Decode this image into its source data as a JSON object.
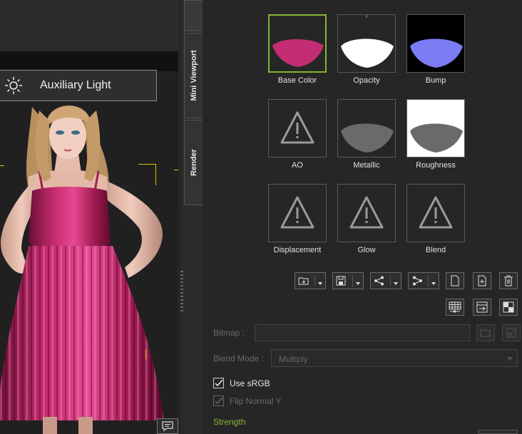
{
  "viewport": {
    "aux_light_label": "Auxiliary Light"
  },
  "tabs": [
    {
      "label": "Mini Viewport"
    },
    {
      "label": "Render"
    }
  ],
  "texture_slots": [
    {
      "label": "Base Color",
      "state": "selected",
      "preview": "pink-dress"
    },
    {
      "label": "Opacity",
      "preview": "white-dress"
    },
    {
      "label": "Bump",
      "preview": "blue-dress"
    },
    {
      "label": "AO",
      "preview": "warning-icon"
    },
    {
      "label": "Metallic",
      "preview": "gray-dress"
    },
    {
      "label": "Roughness",
      "preview": "gray-dress-white-bg"
    },
    {
      "label": "Displacement",
      "preview": "warning-icon"
    },
    {
      "label": "Glow",
      "preview": "warning-icon"
    },
    {
      "label": "Blend",
      "preview": "warning-icon"
    }
  ],
  "toolbar": {
    "row1": [
      "open-folder-icon",
      "save-icon",
      "share-out-icon",
      "share-in-icon",
      "new-document-icon",
      "add-document-icon",
      "trash-icon"
    ],
    "row2": [
      "grid-adjust-icon",
      "export-frame-icon",
      "checker-icon"
    ]
  },
  "bitmap": {
    "label": "Bitmap :",
    "value": ""
  },
  "blend_mode": {
    "label": "Blend Mode :",
    "value": "Multiply"
  },
  "use_srgb": {
    "label": "Use sRGB",
    "checked": true
  },
  "flip_normal_y": {
    "label": "Flip Normal Y",
    "checked": true,
    "disabled": true
  },
  "strength": {
    "label": "Strength"
  },
  "colors": {
    "accent": "#84b536",
    "dress": "#b0225a",
    "bump": "#7b7bf4"
  }
}
